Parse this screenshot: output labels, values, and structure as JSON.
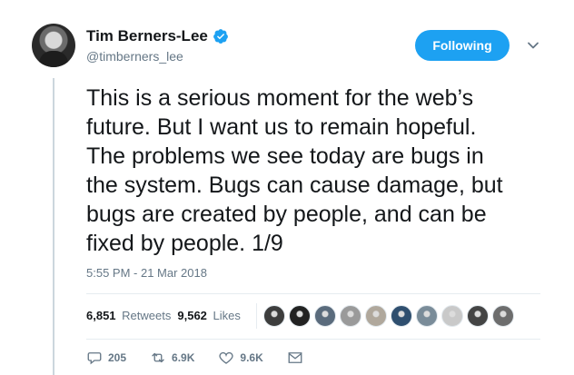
{
  "author": {
    "name": "Tim Berners-Lee",
    "handle": "@timberners_lee",
    "verified": true
  },
  "follow_button": {
    "label": "Following"
  },
  "tweet": {
    "lines": [
      "This is a serious moment for the web’s",
      "future. But I want us to remain hopeful.",
      "The problems we see today are bugs in",
      "the system. Bugs can cause damage, but",
      "bugs are created by people, and can be",
      "fixed by people. 1/9"
    ],
    "timestamp": "5:55 PM - 21 Mar 2018"
  },
  "stats": {
    "retweets_count": "6,851",
    "retweets_label": "Retweets",
    "likes_count": "9,562",
    "likes_label": "Likes"
  },
  "likers": [
    {
      "color": "#3d3d3d"
    },
    {
      "color": "#222222"
    },
    {
      "color": "#5a6b7c"
    },
    {
      "color": "#9a9a9a"
    },
    {
      "color": "#b0a89c"
    },
    {
      "color": "#2f4f6f"
    },
    {
      "color": "#7a8c99"
    },
    {
      "color": "#c9c9c9"
    },
    {
      "color": "#444444"
    },
    {
      "color": "#6d6d6d"
    }
  ],
  "actions": {
    "replies": "205",
    "retweets": "6.9K",
    "likes": "9.6K"
  },
  "colors": {
    "accent": "#1da1f2",
    "muted": "#657786",
    "text": "#14171a"
  }
}
